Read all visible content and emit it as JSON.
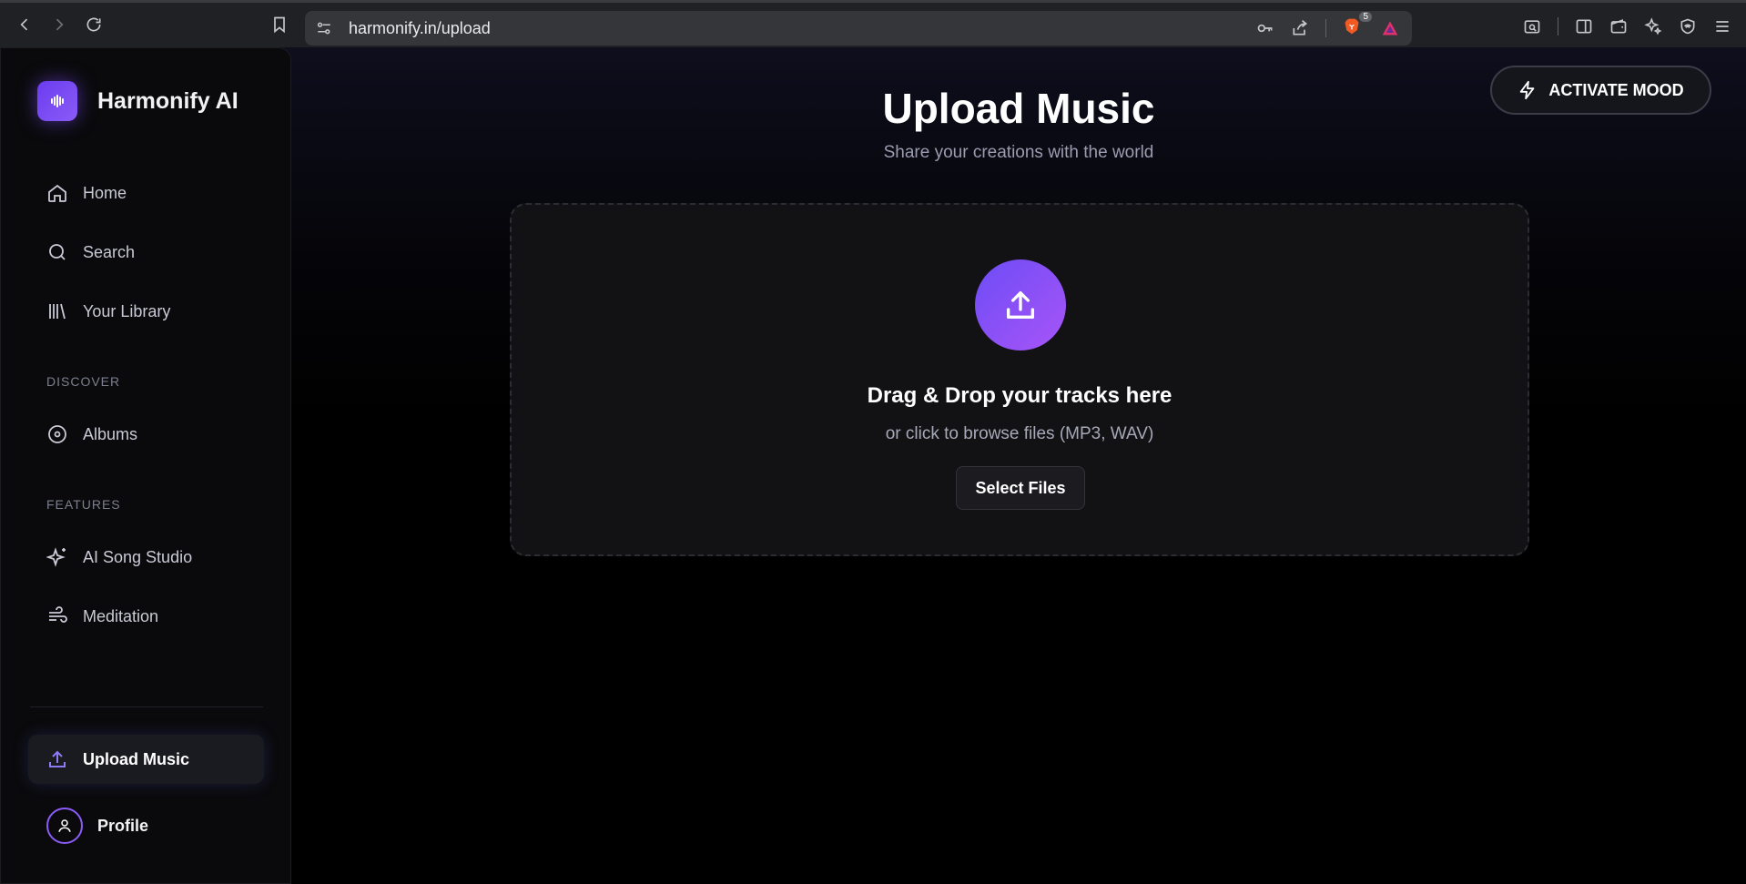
{
  "browser": {
    "url": "harmonify.in/upload",
    "brave_badge_count": "5"
  },
  "sidebar": {
    "brand": "Harmonify AI",
    "items": [
      {
        "label": "Home",
        "icon": "home-icon"
      },
      {
        "label": "Search",
        "icon": "search-icon"
      },
      {
        "label": "Your Library",
        "icon": "library-icon"
      }
    ],
    "discover_label": "DISCOVER",
    "discover_items": [
      {
        "label": "Albums",
        "icon": "album-icon"
      }
    ],
    "features_label": "FEATURES",
    "features_items": [
      {
        "label": "AI Song Studio",
        "icon": "sparkles-icon"
      },
      {
        "label": "Meditation",
        "icon": "wind-icon"
      }
    ],
    "upload_label": "Upload Music",
    "profile_label": "Profile"
  },
  "header": {
    "mood_button": "ACTIVATE MOOD"
  },
  "main": {
    "title": "Upload Music",
    "subtitle": "Share your creations with the world",
    "dropzone": {
      "title": "Drag & Drop your tracks here",
      "subtitle": "or click to browse files (MP3, WAV)",
      "button": "Select Files"
    }
  },
  "colors": {
    "accent": "#8b5cf6",
    "accent_start": "#6d4cf5",
    "background": "#000000"
  }
}
